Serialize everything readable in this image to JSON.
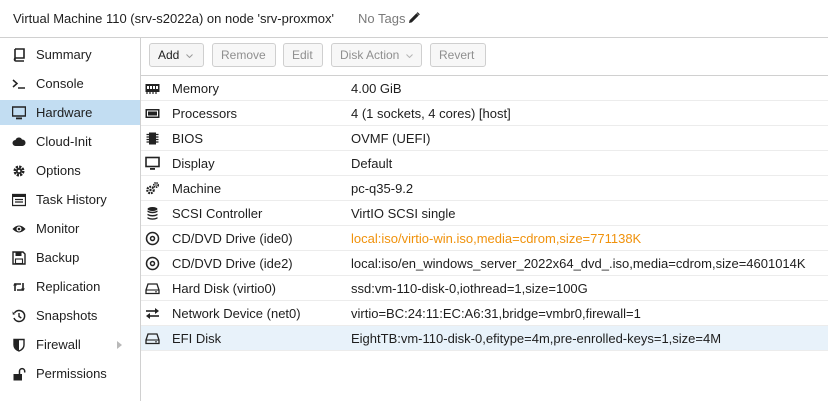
{
  "header": {
    "title": "Virtual Machine 110 (srv-s2022a) on node 'srv-proxmox'",
    "tags": "No Tags",
    "tags_icon": "pencil-icon"
  },
  "sidebar": {
    "items": [
      {
        "label": "Summary",
        "icon": "book-icon"
      },
      {
        "label": "Console",
        "icon": "terminal-icon"
      },
      {
        "label": "Hardware",
        "icon": "monitor-icon",
        "active": true
      },
      {
        "label": "Cloud-Init",
        "icon": "cloud-icon"
      },
      {
        "label": "Options",
        "icon": "gear-icon"
      },
      {
        "label": "Task History",
        "icon": "list-icon"
      },
      {
        "label": "Monitor",
        "icon": "eye-icon"
      },
      {
        "label": "Backup",
        "icon": "floppy-icon"
      },
      {
        "label": "Replication",
        "icon": "retweet-icon"
      },
      {
        "label": "Snapshots",
        "icon": "history-icon"
      },
      {
        "label": "Firewall",
        "icon": "shield-icon",
        "expandable": true
      },
      {
        "label": "Permissions",
        "icon": "unlock-icon"
      }
    ]
  },
  "toolbar": {
    "add_label": "Add",
    "remove_label": "Remove",
    "edit_label": "Edit",
    "disk_action_label": "Disk Action",
    "revert_label": "Revert"
  },
  "hardware": {
    "rows": [
      {
        "name": "Memory",
        "value": "4.00 GiB",
        "icon": "memory-icon"
      },
      {
        "name": "Processors",
        "value": "4 (1 sockets, 4 cores) [host]",
        "icon": "cpu-icon"
      },
      {
        "name": "BIOS",
        "value": "OVMF (UEFI)",
        "icon": "chip-icon"
      },
      {
        "name": "Display",
        "value": "Default",
        "icon": "desktop-icon"
      },
      {
        "name": "Machine",
        "value": "pc-q35-9.2",
        "icon": "cogs-icon"
      },
      {
        "name": "SCSI Controller",
        "value": "VirtIO SCSI single",
        "icon": "database-icon"
      },
      {
        "name": "CD/DVD Drive (ide0)",
        "value": "local:iso/virtio-win.iso,media=cdrom,size=771138K",
        "icon": "cdrom-icon",
        "pending": true
      },
      {
        "name": "CD/DVD Drive (ide2)",
        "value": "local:iso/en_windows_server_2022x64_dvd_.iso,media=cdrom,size=4601014K",
        "icon": "cdrom-icon"
      },
      {
        "name": "Hard Disk (virtio0)",
        "value": "ssd:vm-110-disk-0,iothread=1,size=100G",
        "icon": "hdd-icon"
      },
      {
        "name": "Network Device (net0)",
        "value": "virtio=BC:24:11:EC:A6:31,bridge=vmbr0,firewall=1",
        "icon": "exchange-icon"
      },
      {
        "name": "EFI Disk",
        "value": "EightTB:vm-110-disk-0,efitype=4m,pre-enrolled-keys=1,size=4M",
        "icon": "hdd-icon",
        "selected": true
      }
    ]
  },
  "colors": {
    "selected_nav": "#c2ddf2",
    "selected_row": "#e8f2fa",
    "pending_value": "#f0920c"
  }
}
